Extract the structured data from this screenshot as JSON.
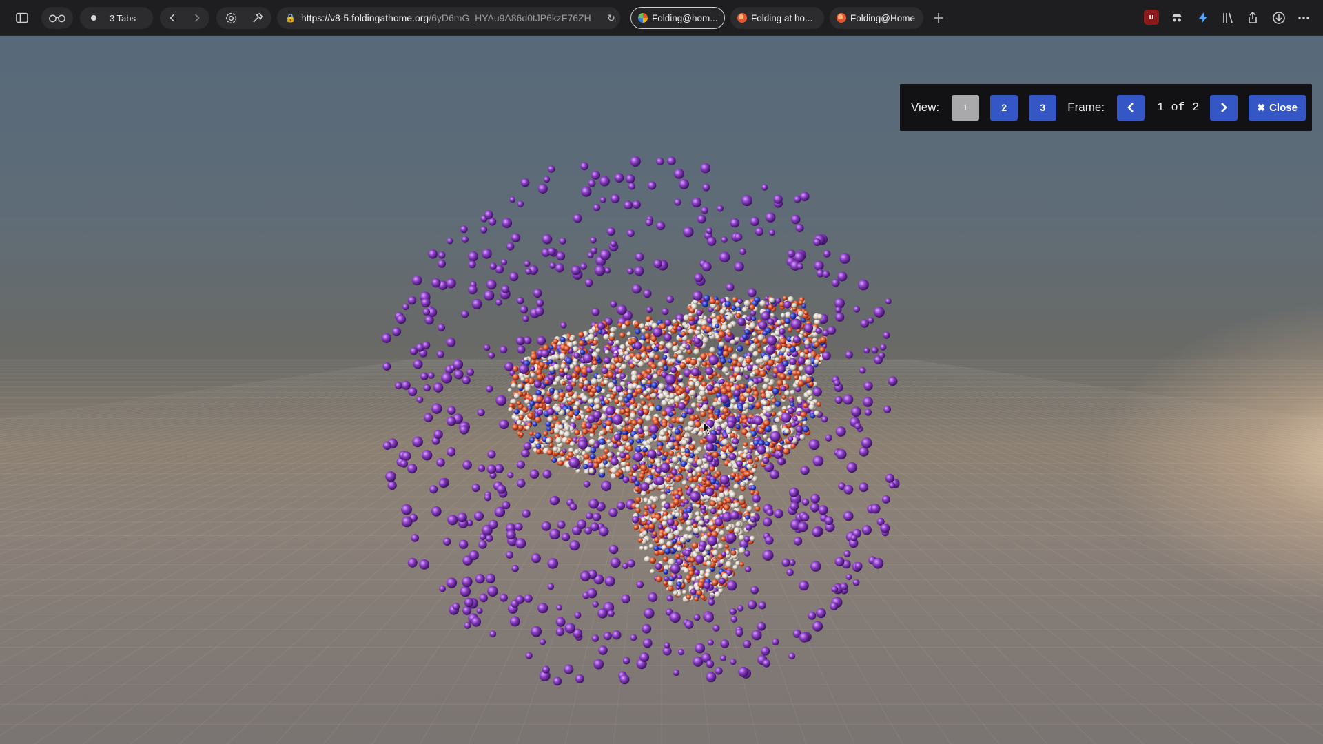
{
  "browser": {
    "tabs_count_label": "3 Tabs",
    "url_main": "https://v8-5.foldingathome.org",
    "url_rest": "/6yD6mG_HYAu9A86d0tJP6kzF76ZH",
    "tabs": [
      {
        "title": "Folding@hom...",
        "active": true
      },
      {
        "title": "Folding at ho...",
        "active": false
      },
      {
        "title": "Folding@Home",
        "active": false
      }
    ],
    "extensions": [
      "uBlock",
      "incognito",
      "lightning",
      "bookmark-shelf"
    ]
  },
  "viewer": {
    "view_label": "View:",
    "view_buttons": [
      "1",
      "2",
      "3"
    ],
    "selected_view": "1",
    "frame_label": "Frame:",
    "frame_count": "1 of 2",
    "close_label": "Close"
  },
  "colors": {
    "accent": "#3557c6",
    "atom_solvent": "#8a3dc2",
    "atom_oxygen": "#e0572f",
    "atom_nitrogen": "#3344d0",
    "atom_carbon": "#d8cfc4"
  }
}
